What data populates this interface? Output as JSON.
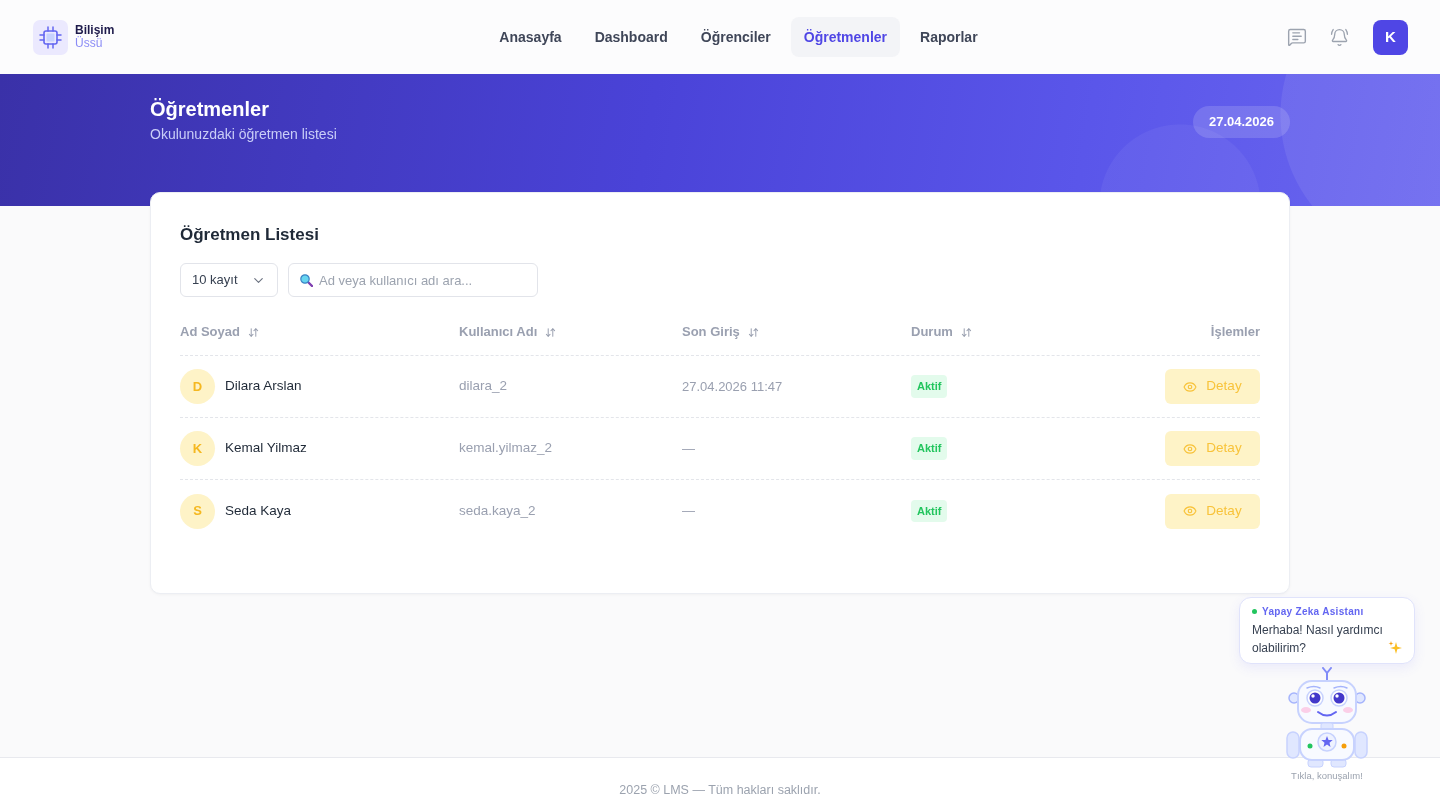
{
  "header": {
    "logo": {
      "line1": "Bilişim",
      "line2": "Üssü"
    },
    "nav": [
      {
        "label": "Anasayfa",
        "selected": false
      },
      {
        "label": "Dashboard",
        "selected": false
      },
      {
        "label": "Öğrenciler",
        "selected": false
      },
      {
        "label": "Öğretmenler",
        "selected": true
      },
      {
        "label": "Raporlar",
        "selected": false
      }
    ],
    "user_initial": "K"
  },
  "hero": {
    "title": "Öğretmenler",
    "subtitle": "Okulunuzdaki öğretmen listesi",
    "date": "27.04.2026"
  },
  "card": {
    "title": "Öğretmen Listesi",
    "page_size": "10 kayıt",
    "search": {
      "placeholder": "Ad veya kullanıcı adı ara..."
    },
    "table": {
      "columns": [
        {
          "label": "Ad Soyad",
          "sortable": true
        },
        {
          "label": "Kullanıcı Adı",
          "sortable": true
        },
        {
          "label": "Son Giriş",
          "sortable": true
        },
        {
          "label": "Durum",
          "sortable": true
        },
        {
          "label": "İşlemler",
          "sortable": false
        }
      ],
      "rows": [
        {
          "initial": "D",
          "name": "Dilara Arslan",
          "username": "dilara_2",
          "last_login": "27.04.2026 11:47",
          "status": "Aktif",
          "action": "Detay"
        },
        {
          "initial": "K",
          "name": "Kemal Yilmaz",
          "username": "kemal.yilmaz_2",
          "last_login": "—",
          "status": "Aktif",
          "action": "Detay"
        },
        {
          "initial": "S",
          "name": "Seda Kaya",
          "username": "seda.kaya_2",
          "last_login": "—",
          "status": "Aktif",
          "action": "Detay"
        }
      ]
    }
  },
  "assistant": {
    "title": "Yapay Zeka Asistanı",
    "message": "Merhaba! Nasıl yardımcı olabilirim?",
    "caption": "Tıkla, konuşalım!"
  },
  "footer": "2025 © LMS — Tüm hakları saklıdır."
}
